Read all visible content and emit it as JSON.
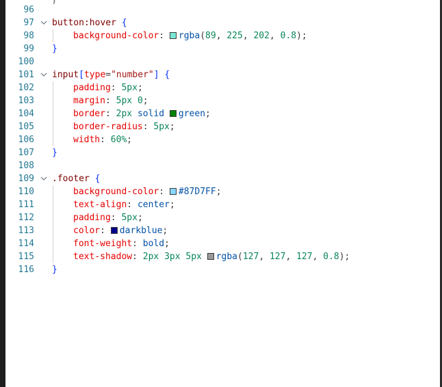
{
  "top_fragment": "}",
  "lines": [
    {
      "n": "96",
      "tokens": []
    },
    {
      "n": "97",
      "fold": true,
      "tokens": [
        {
          "t": "button:hover",
          "c": "sel"
        },
        {
          "t": " "
        },
        {
          "t": "{",
          "c": "brace"
        }
      ]
    },
    {
      "n": "98",
      "indent": 1,
      "tokens": [
        {
          "t": "background-color",
          "c": "prop"
        },
        {
          "t": ": "
        },
        {
          "swatch": "rgba(89, 225, 202, 0.8)"
        },
        {
          "t": "rgba",
          "c": "val"
        },
        {
          "t": "(",
          "c": "punc"
        },
        {
          "t": "89",
          "c": "num"
        },
        {
          "t": ", "
        },
        {
          "t": "225",
          "c": "num"
        },
        {
          "t": ", "
        },
        {
          "t": "202",
          "c": "num"
        },
        {
          "t": ", "
        },
        {
          "t": "0.8",
          "c": "num"
        },
        {
          "t": ");",
          "c": "punc"
        }
      ]
    },
    {
      "n": "99",
      "tokens": [
        {
          "t": "}",
          "c": "brace"
        }
      ]
    },
    {
      "n": "100",
      "tokens": []
    },
    {
      "n": "101",
      "fold": true,
      "tokens": [
        {
          "t": "input",
          "c": "sel"
        },
        {
          "t": "[",
          "c": "brace"
        },
        {
          "t": "type",
          "c": "attr"
        },
        {
          "t": "="
        },
        {
          "t": "\"number\"",
          "c": "str"
        },
        {
          "t": "]",
          "c": "brace"
        },
        {
          "t": " "
        },
        {
          "t": "{",
          "c": "brace"
        }
      ]
    },
    {
      "n": "102",
      "indent": 1,
      "tokens": [
        {
          "t": "padding",
          "c": "prop"
        },
        {
          "t": ": "
        },
        {
          "t": "5px",
          "c": "num"
        },
        {
          "t": ";"
        }
      ]
    },
    {
      "n": "103",
      "indent": 1,
      "tokens": [
        {
          "t": "margin",
          "c": "prop"
        },
        {
          "t": ": "
        },
        {
          "t": "5px",
          "c": "num"
        },
        {
          "t": " "
        },
        {
          "t": "0",
          "c": "num"
        },
        {
          "t": ";"
        }
      ]
    },
    {
      "n": "104",
      "indent": 1,
      "tokens": [
        {
          "t": "border",
          "c": "prop"
        },
        {
          "t": ": "
        },
        {
          "t": "2px",
          "c": "num"
        },
        {
          "t": " "
        },
        {
          "t": "solid",
          "c": "val"
        },
        {
          "t": " "
        },
        {
          "swatch": "green"
        },
        {
          "t": "green",
          "c": "val"
        },
        {
          "t": ";"
        }
      ]
    },
    {
      "n": "105",
      "indent": 1,
      "tokens": [
        {
          "t": "border-radius",
          "c": "prop"
        },
        {
          "t": ": "
        },
        {
          "t": "5px",
          "c": "num"
        },
        {
          "t": ";"
        }
      ]
    },
    {
      "n": "106",
      "indent": 1,
      "tokens": [
        {
          "t": "width",
          "c": "prop"
        },
        {
          "t": ": "
        },
        {
          "t": "60%",
          "c": "num"
        },
        {
          "t": ";"
        }
      ]
    },
    {
      "n": "107",
      "tokens": [
        {
          "t": "}",
          "c": "brace"
        }
      ]
    },
    {
      "n": "108",
      "tokens": []
    },
    {
      "n": "109",
      "fold": true,
      "tokens": [
        {
          "t": ".footer",
          "c": "sel"
        },
        {
          "t": " "
        },
        {
          "t": "{",
          "c": "brace"
        }
      ]
    },
    {
      "n": "110",
      "indent": 1,
      "tokens": [
        {
          "t": "background-color",
          "c": "prop"
        },
        {
          "t": ": "
        },
        {
          "swatch": "#87D7FF"
        },
        {
          "t": "#87D7FF",
          "c": "val"
        },
        {
          "t": ";"
        }
      ]
    },
    {
      "n": "111",
      "indent": 1,
      "tokens": [
        {
          "t": "text-align",
          "c": "prop"
        },
        {
          "t": ": "
        },
        {
          "t": "center",
          "c": "val"
        },
        {
          "t": ";"
        }
      ]
    },
    {
      "n": "112",
      "indent": 1,
      "tokens": [
        {
          "t": "padding",
          "c": "prop"
        },
        {
          "t": ": "
        },
        {
          "t": "5px",
          "c": "num"
        },
        {
          "t": ";"
        }
      ]
    },
    {
      "n": "113",
      "indent": 1,
      "tokens": [
        {
          "t": "color",
          "c": "prop"
        },
        {
          "t": ": "
        },
        {
          "swatch": "darkblue"
        },
        {
          "t": "darkblue",
          "c": "val"
        },
        {
          "t": ";"
        }
      ]
    },
    {
      "n": "114",
      "indent": 1,
      "tokens": [
        {
          "t": "font-weight",
          "c": "prop"
        },
        {
          "t": ": "
        },
        {
          "t": "bold",
          "c": "val"
        },
        {
          "t": ";"
        }
      ]
    },
    {
      "n": "115",
      "indent": 1,
      "tokens": [
        {
          "t": "text-shadow",
          "c": "prop"
        },
        {
          "t": ": "
        },
        {
          "t": "2px",
          "c": "num"
        },
        {
          "t": " "
        },
        {
          "t": "3px",
          "c": "num"
        },
        {
          "t": " "
        },
        {
          "t": "5px",
          "c": "num"
        },
        {
          "t": " "
        },
        {
          "swatch": "rgba(127, 127, 127, 0.8)"
        },
        {
          "t": "rgba",
          "c": "val"
        },
        {
          "t": "(",
          "c": "punc"
        },
        {
          "t": "127",
          "c": "num"
        },
        {
          "t": ", "
        },
        {
          "t": "127",
          "c": "num"
        },
        {
          "t": ", "
        },
        {
          "t": "127",
          "c": "num"
        },
        {
          "t": ", "
        },
        {
          "t": "0.8",
          "c": "num"
        },
        {
          "t": ");",
          "c": "punc"
        }
      ]
    },
    {
      "n": "116",
      "tokens": [
        {
          "t": "}",
          "c": "brace"
        }
      ]
    }
  ],
  "colors": {
    "line_number": "#237893",
    "selector": "#800000",
    "property": "#e50000",
    "number": "#098658",
    "value": "#0451a5",
    "brace": "#0431fa"
  }
}
